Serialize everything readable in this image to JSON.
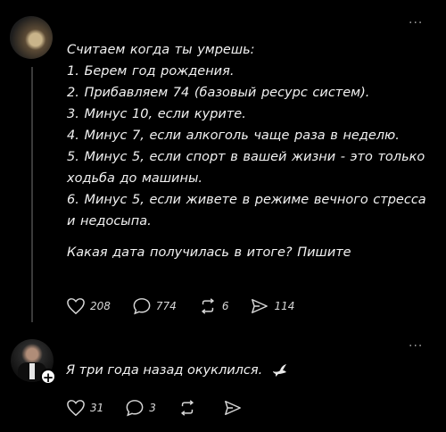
{
  "post": {
    "lines": [
      "Считаем когда ты умрешь:",
      "1. Берем год рождения.",
      "2. Прибавляем 74 (базовый ресурс систем).",
      "3. Минус 10, если курите.",
      "4. Минус 7, если алкоголь чаще раза в неделю.",
      "5. Минус 5, если спорт в вашей жизни - это только",
      "ходьба до машины.",
      "6. Минус 5, если живете в режиме вечного стресса",
      "и недосыпа."
    ],
    "question": "Какая дата получилась в итоге? Пишите",
    "likes": "208",
    "comments": "774",
    "reposts": "6",
    "shares": "114"
  },
  "reply": {
    "text": "Я три года назад окуклился.",
    "likes": "31",
    "comments": "3",
    "icons": [
      "heart-icon",
      "comment-icon",
      "repost-icon",
      "share-icon",
      "dove-icon",
      "plus-icon"
    ]
  },
  "more_glyph": "···",
  "plus_glyph": "+"
}
